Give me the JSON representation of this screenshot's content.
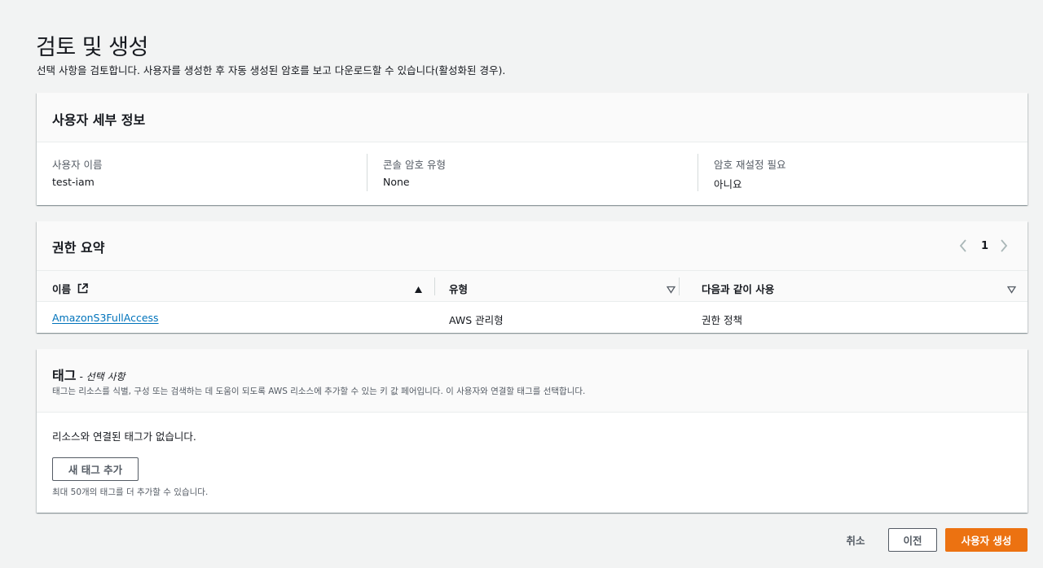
{
  "page": {
    "title": "검토 및 생성",
    "description": "선택 사항을 검토합니다. 사용자를 생성한 후 자동 생성된 암호를 보고 다운로드할 수 있습니다(활성화된 경우)."
  },
  "user_details": {
    "title": "사용자 세부 정보",
    "fields": [
      {
        "label": "사용자 이름",
        "value": "test-iam"
      },
      {
        "label": "콘솔 암호 유형",
        "value": "None"
      },
      {
        "label": "암호 재설정 필요",
        "value": "아니요"
      }
    ]
  },
  "permissions": {
    "title": "권한 요약",
    "page_number": "1",
    "columns": [
      {
        "label": "이름",
        "sort": "ascending",
        "icon": "external-link-icon"
      },
      {
        "label": "유형",
        "sort": "none"
      },
      {
        "label": "다음과 같이 사용",
        "sort": "none"
      }
    ],
    "rows": [
      {
        "name": "AmazonS3FullAccess",
        "type": "AWS 관리형",
        "used_as": "권한 정책"
      }
    ]
  },
  "tags": {
    "title": "태그",
    "optional": "- 선택 사항",
    "description": "태그는 리소스를 식별, 구성 또는 검색하는 데 도움이 되도록 AWS 리소스에 추가할 수 있는 키 값 페어입니다. 이 사용자와 연결할 태그를 선택합니다.",
    "empty_text": "리소스와 연결된 태그가 없습니다.",
    "add_button": "새 태그 추가",
    "add_hint": "최대 50개의 태그를 더 추가할 수 있습니다."
  },
  "footer": {
    "cancel": "취소",
    "previous": "이전",
    "create": "사용자 생성"
  },
  "colors": {
    "primary_button": "#ec7211",
    "link": "#0073bb",
    "background": "#f2f3f3"
  }
}
